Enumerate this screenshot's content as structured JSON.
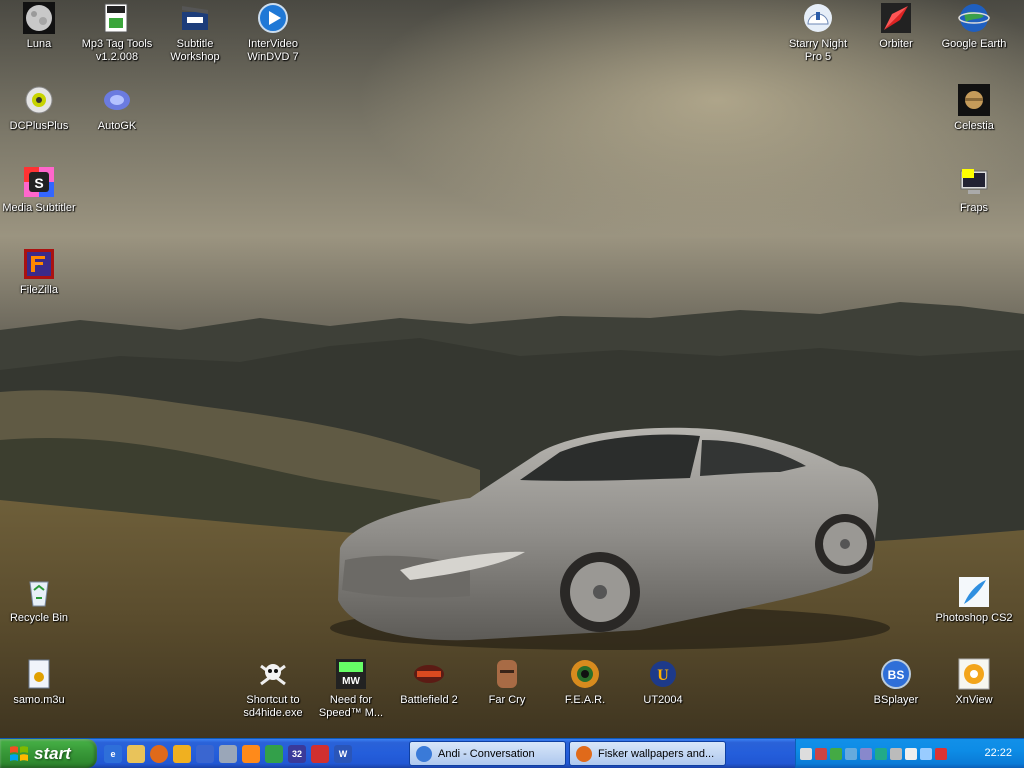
{
  "desktop": {
    "icons": {
      "luna": "Luna",
      "mp3tag": "Mp3 Tag Tools\nv1.2.008",
      "subtitle": "Subtitle\nWorkshop",
      "windvd": "InterVideo\nWinDVD 7",
      "starry": "Starry Night\nPro 5",
      "orbiter": "Orbiter",
      "gearth": "Google Earth",
      "dcplus": "DCPlusPlus",
      "autogk": "AutoGK",
      "celestia": "Celestia",
      "mediasub": "Media Subtitler",
      "fraps": "Fraps",
      "filezilla": "FileZilla",
      "recycle": "Recycle Bin",
      "photoshop": "Photoshop CS2",
      "samo": "samo.m3u",
      "sd4hide": "Shortcut to\nsd4hide.exe",
      "nfs": "Need for\nSpeed™ M...",
      "bf2": "Battlefield 2",
      "farcry": "Far Cry",
      "fear": "F.E.A.R.",
      "ut2004": "UT2004",
      "bsplayer": "BSplayer",
      "xnview": "XnView"
    }
  },
  "taskbar": {
    "start_label": "start",
    "buttons": {
      "andi": "Andi  - Conversation",
      "fisker": "Fisker wallpapers and..."
    },
    "clock": "22:22"
  }
}
